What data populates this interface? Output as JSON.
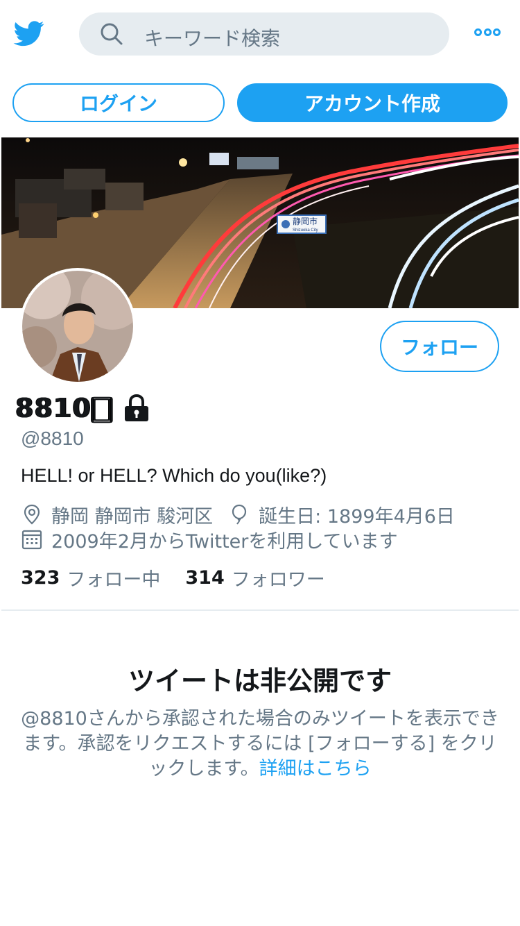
{
  "header": {
    "search_placeholder": "キーワード検索"
  },
  "auth": {
    "login_label": "ログイン",
    "signup_label": "アカウント作成"
  },
  "banner": {
    "sign_text": "静岡市",
    "sign_subtext": "Shizuoka City"
  },
  "profile": {
    "display_name": "8810🀆",
    "handle": "@8810",
    "follow_label": "フォロー",
    "bio": "HELL! or HELL? Which do you(like?)",
    "location": "静岡 静岡市 駿河区",
    "birthday": "誕生日: 1899年4月6日",
    "joined": "2009年2月からTwitterを利用しています",
    "following_count": "323",
    "following_label": "フォロー中",
    "followers_count": "314",
    "followers_label": "フォロワー"
  },
  "protected": {
    "title": "ツイートは非公開です",
    "body": "@8810さんから承認された場合のみツイートを表示できます。承認をリクエストするには [フォローする] をクリックします。",
    "link": "詳細はこちら"
  },
  "colors": {
    "accent": "#1da1f2",
    "secondary_text": "#657786",
    "search_bg": "#e6ecf0"
  },
  "icons": [
    "twitter-logo-icon",
    "search-icon",
    "more-icon",
    "lock-icon",
    "location-icon",
    "balloon-icon",
    "calendar-icon"
  ]
}
